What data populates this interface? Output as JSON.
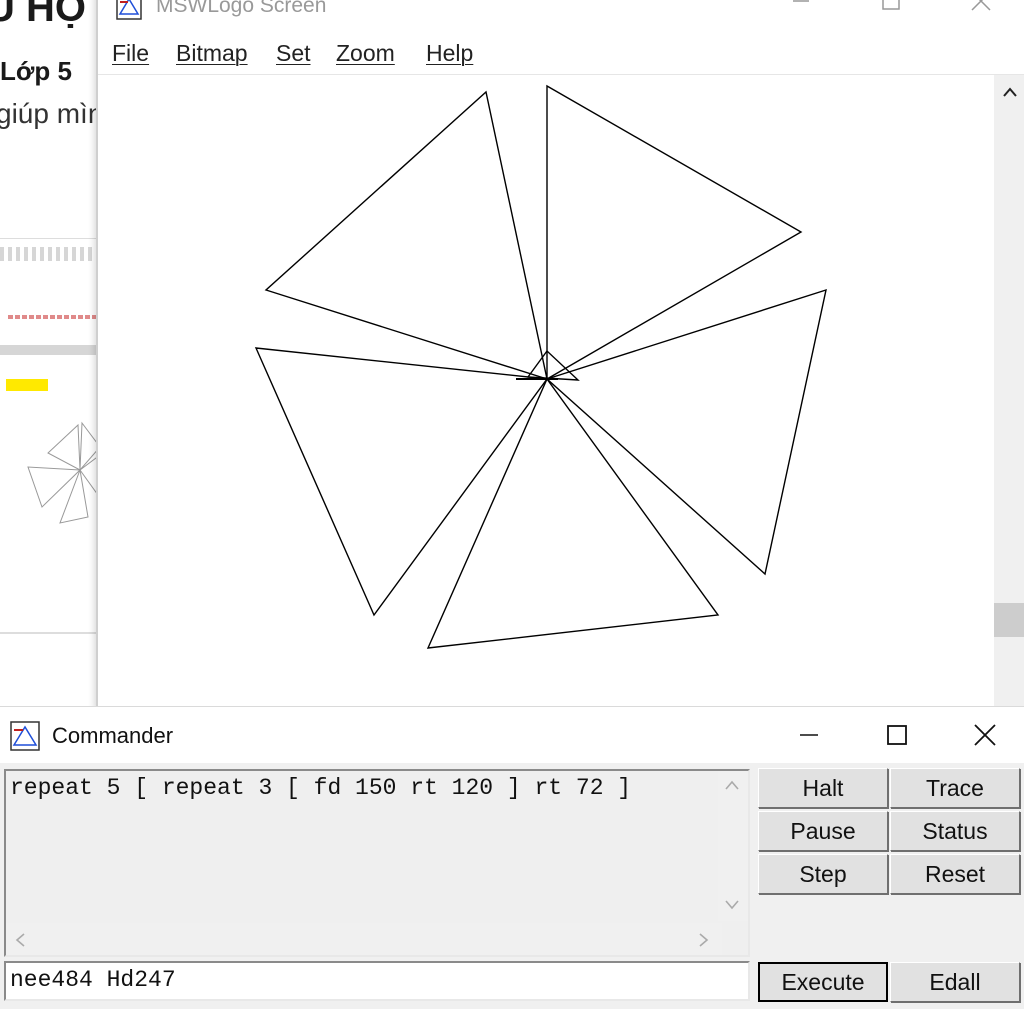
{
  "background_doc": {
    "heading": "U HỌ",
    "subheading": "Lớp 5",
    "text": "giúp mìn"
  },
  "logo_window": {
    "title": "MSWLogo Screen",
    "menu": [
      "File",
      "Bitmap",
      "Set",
      "Zoom",
      "Help"
    ],
    "icons": {
      "minimize": "minimize-icon",
      "maximize": "maximize-icon",
      "close": "close-icon",
      "scroll_up": "chevron-up-icon"
    }
  },
  "commander": {
    "title": "Commander",
    "history": "repeat 5 [ repeat 3 [ fd 150 rt 120 ] rt 72 ]",
    "input": "nee484 Hd247",
    "buttons": {
      "halt": "Halt",
      "trace": "Trace",
      "pause": "Pause",
      "status": "Status",
      "step": "Step",
      "reset": "Reset",
      "execute": "Execute",
      "edall": "Edall"
    }
  },
  "colors": {
    "window_bg": "#f0f0f0",
    "canvas_bg": "#ffffff",
    "pen": "#000000",
    "highlight": "#ffe900"
  }
}
